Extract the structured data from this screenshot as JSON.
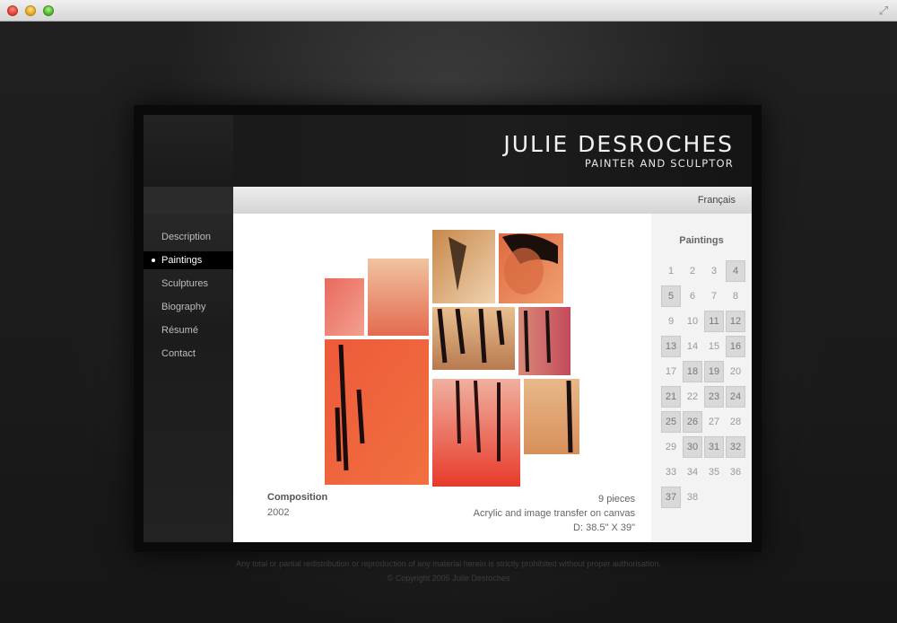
{
  "site": {
    "name": "JULIE DESROCHES",
    "tagline": "PAINTER AND SCULPTOR"
  },
  "nav": {
    "items": [
      {
        "label": "Description",
        "active": false
      },
      {
        "label": "Paintings",
        "active": true
      },
      {
        "label": "Sculptures",
        "active": false
      },
      {
        "label": "Biography",
        "active": false
      },
      {
        "label": "Résumé",
        "active": false
      },
      {
        "label": "Contact",
        "active": false
      }
    ]
  },
  "lang": {
    "label": "Français"
  },
  "artwork": {
    "title": "Composition",
    "year": "2002",
    "pieces": "9 pieces",
    "medium": "Acrylic and image transfer on canvas",
    "dimensions": "D: 38.5\" X 39\""
  },
  "gallery": {
    "title": "Paintings",
    "numbers": [
      "1",
      "2",
      "3",
      "4",
      "5",
      "6",
      "7",
      "8",
      "9",
      "10",
      "11",
      "12",
      "13",
      "14",
      "15",
      "16",
      "17",
      "18",
      "19",
      "20",
      "21",
      "22",
      "23",
      "24",
      "25",
      "26",
      "27",
      "28",
      "29",
      "30",
      "31",
      "32",
      "33",
      "34",
      "35",
      "36",
      "37",
      "38"
    ],
    "boxed": [
      "4",
      "5",
      "11",
      "12",
      "13",
      "16",
      "18",
      "19",
      "21",
      "23",
      "24",
      "25",
      "26",
      "30",
      "31",
      "32",
      "37"
    ]
  },
  "footer": {
    "notice": "Any total or partial redistribution or reproduction of any material herein is strictly prohibited without proper authorisation.",
    "copyright": "© Copyright 2005 Julie Desroches"
  },
  "colors": {
    "accent_red": "#e8402a",
    "nav_active_bg": "#000000",
    "page_bg": "#1a1a1a"
  }
}
